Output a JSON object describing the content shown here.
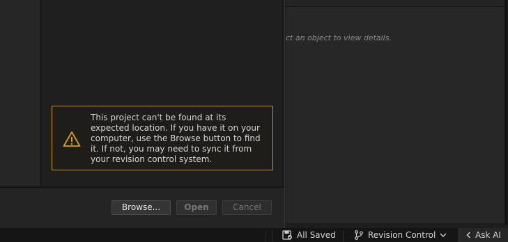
{
  "details_panel": {
    "hint": "ct an object to view details."
  },
  "dialog": {
    "warning": {
      "icon": "warning-triangle-icon",
      "accent": "#c99a1a",
      "message": "This project can't be found at its expected location. If you have it on your computer, use the Browse button to find it. If not, you may need to sync it from your revision control system."
    },
    "buttons": {
      "browse": "Browse...",
      "open": "Open",
      "cancel": "Cancel"
    }
  },
  "statusbar": {
    "save_status": "All Saved",
    "save_icon": "save-icon",
    "revision_control": "Revision Control",
    "revision_icon": "branch-icon",
    "ask_ai": "Ask AI"
  }
}
